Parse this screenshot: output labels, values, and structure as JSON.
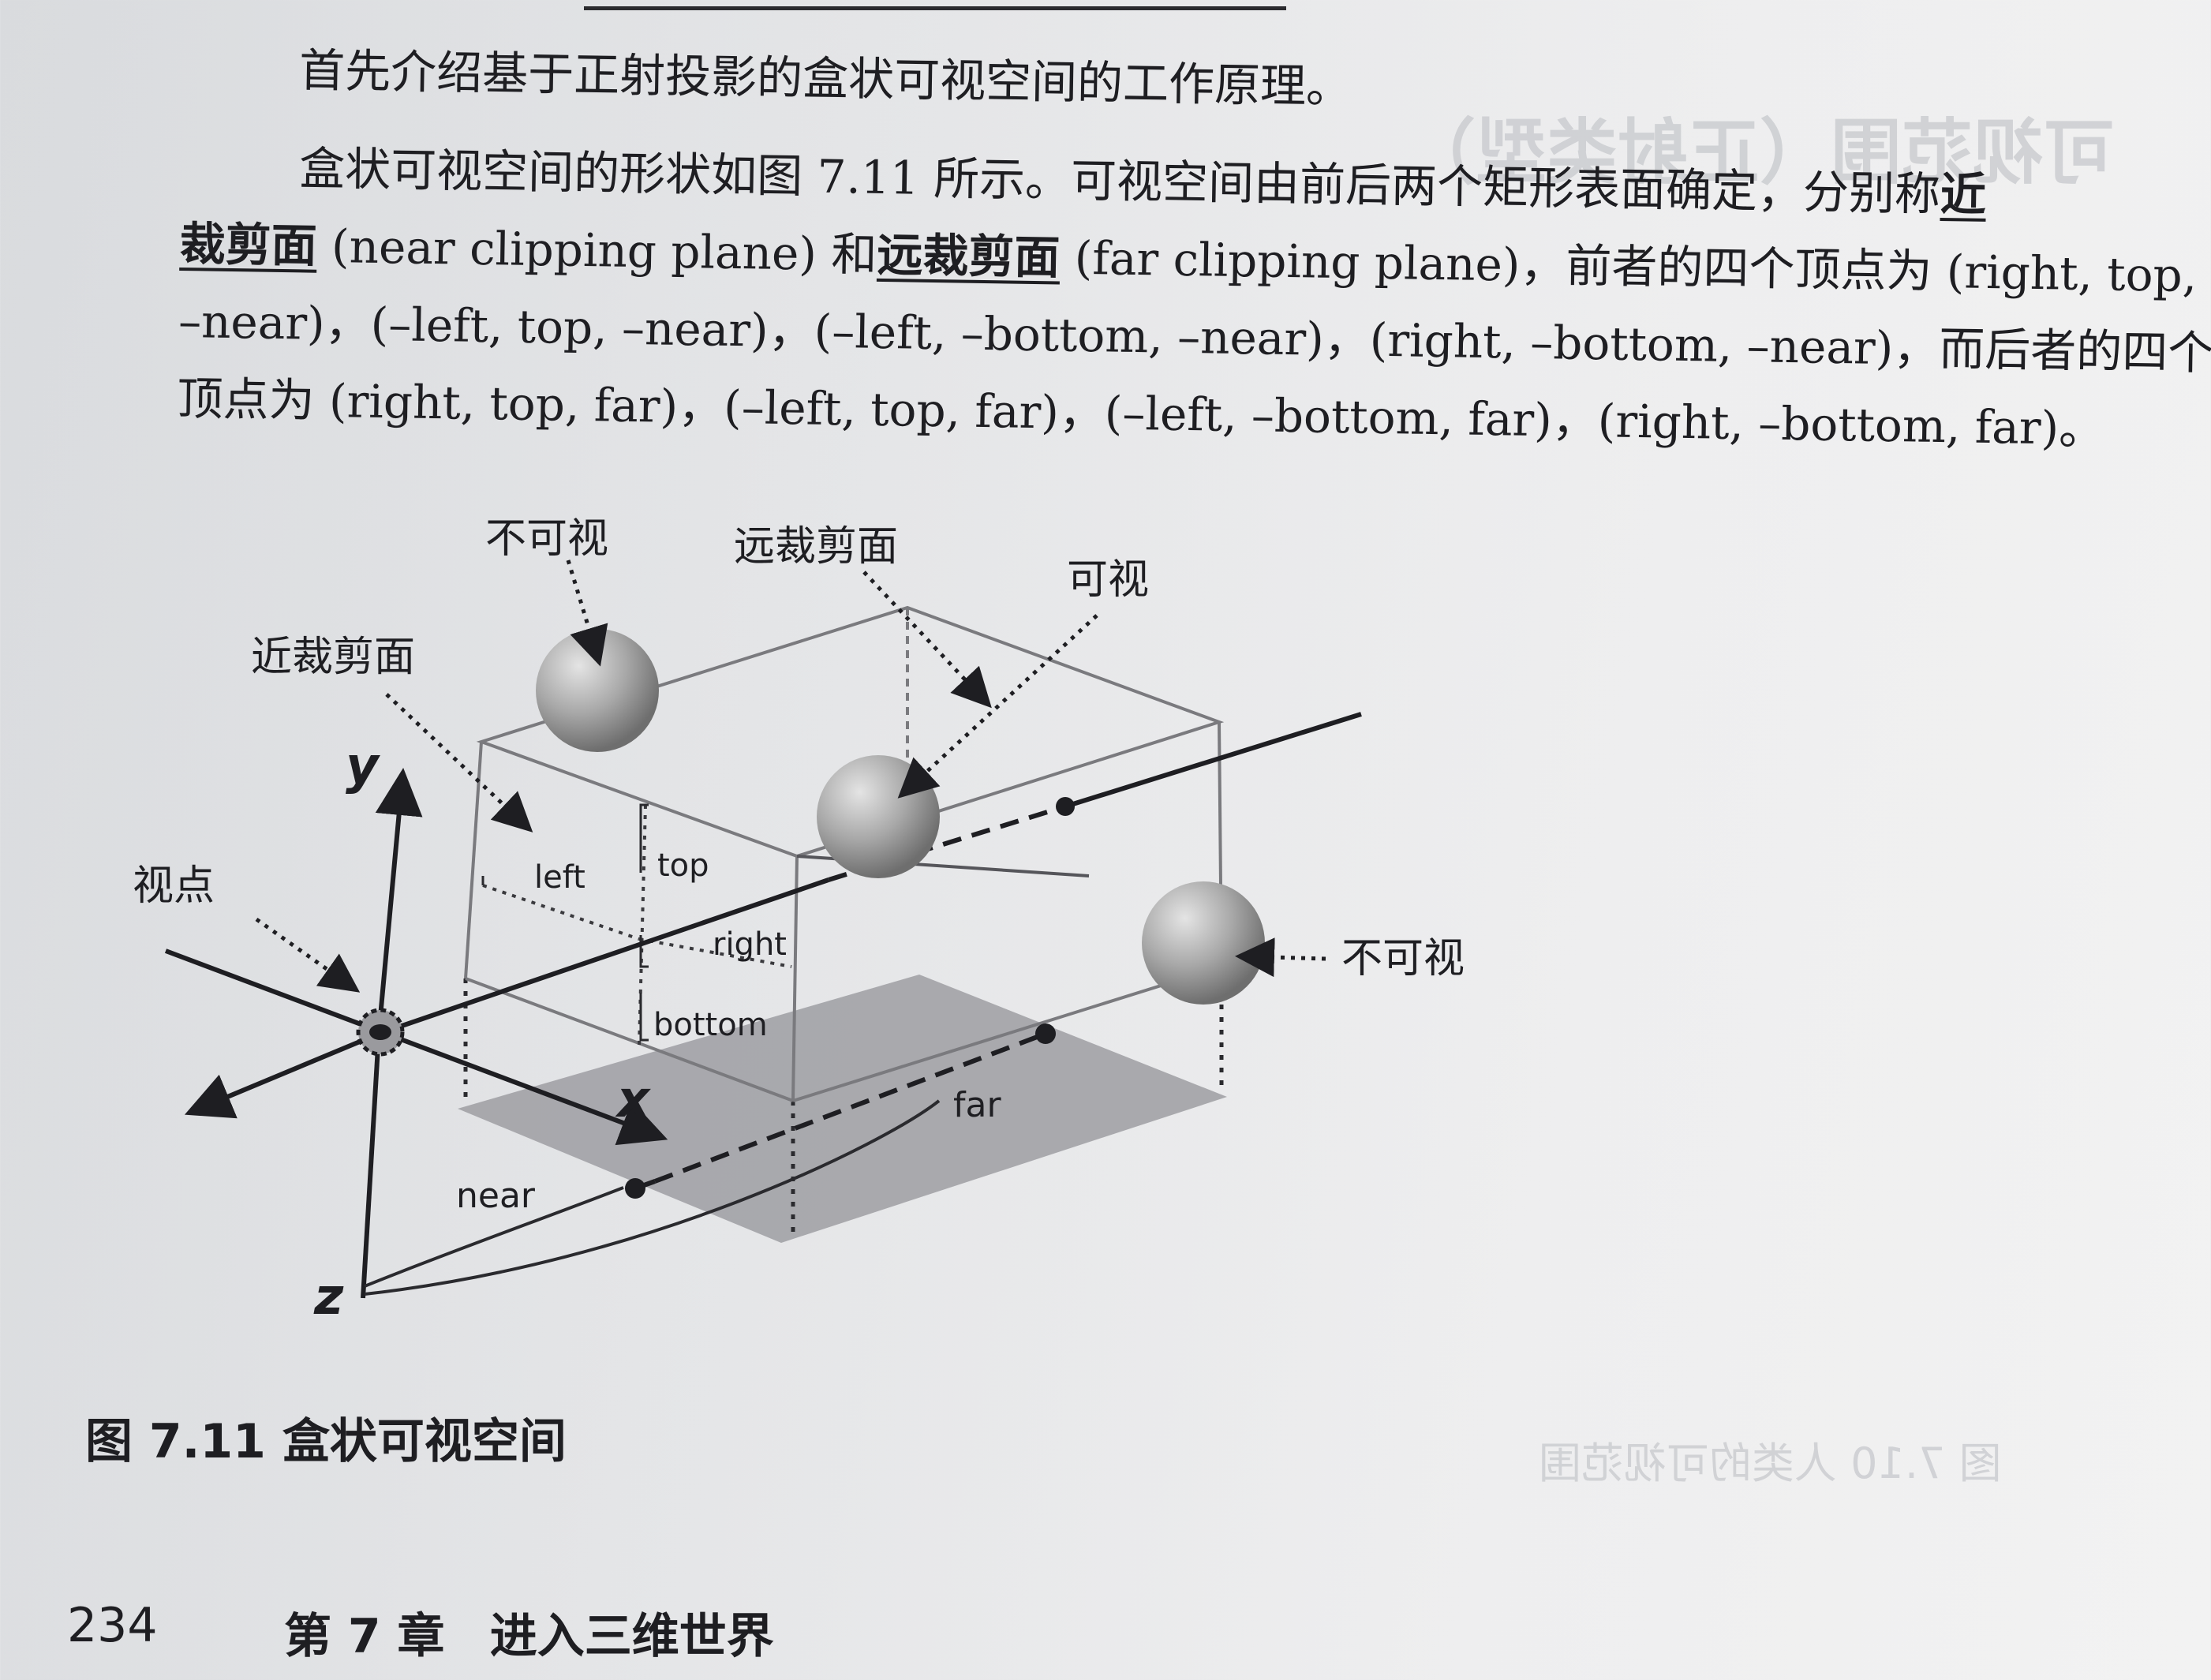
{
  "body_text": {
    "line1": "首先介绍基于正射投影的盒状可视空间的工作原理。",
    "para2_line1_prefix": "盒状可视空间的形状如图 7.11 所示。可视空间由前后两个矩形表面确定，分别称",
    "term_near_part1": "近",
    "term_near_part2": "裁剪面",
    "near_en": " (near clipping plane) 和",
    "term_far": "远裁剪面",
    "far_en_rest": " (far clipping plane)，前者的四个顶点为 (right, top,",
    "para2_line3": "–near)，(–left, top, –near)，(–left, –bottom, –near)，(right, –bottom, –near)，而后者的四个",
    "para2_line4": "顶点为 (right, top, far)，(–left, top, far)，(–left, –bottom, far)，(right, –bottom, far)。"
  },
  "figure": {
    "labels": {
      "invisible_top": "不可视",
      "far_plane": "远裁剪面",
      "visible": "可视",
      "near_plane": "近裁剪面",
      "axis_y": "y",
      "viewpoint": "视点",
      "left": "left",
      "top": "top",
      "right": "right",
      "bottom": "bottom",
      "invisible_right": "不可视",
      "axis_x": "x",
      "far": "far",
      "near": "near",
      "axis_z": "z"
    }
  },
  "caption": "图 7.11  盒状可视空间",
  "footer": {
    "page_number": "234",
    "chapter": "第 7 章",
    "chapter_title": "进入三维世界"
  }
}
